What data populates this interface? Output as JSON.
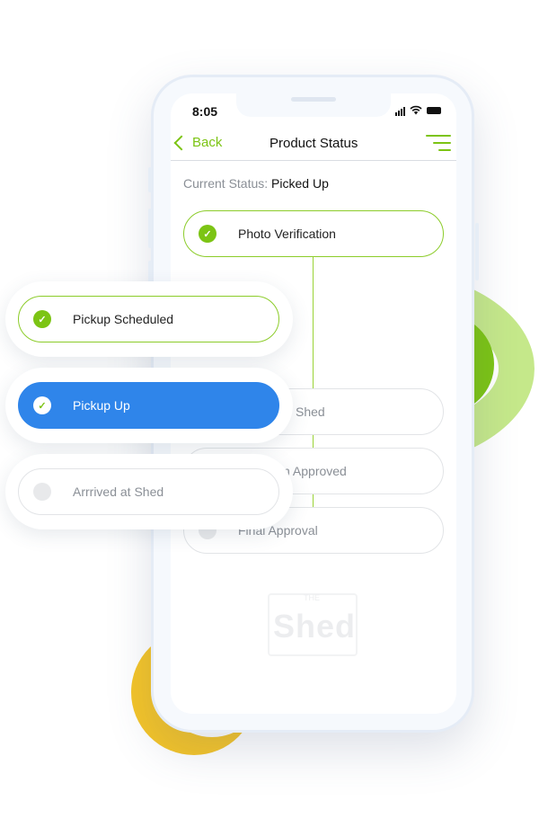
{
  "status_bar": {
    "time": "8:05"
  },
  "nav": {
    "back_label": "Back",
    "title": "Product Status"
  },
  "current_status": {
    "label": "Current Status:",
    "value": "Picked Up"
  },
  "timeline": [
    {
      "label": "Photo Verification",
      "state": "done"
    },
    {
      "label": "Shed",
      "state": "pending"
    },
    {
      "label": "n Approved",
      "state": "pending"
    },
    {
      "label": "Final Approval",
      "state": "pending"
    }
  ],
  "floating_cards": [
    {
      "label": "Pickup Scheduled",
      "state": "done"
    },
    {
      "label": "Pickup Up",
      "state": "active"
    },
    {
      "label": "Arrrived at Shed",
      "state": "pending"
    }
  ],
  "watermark": {
    "the": "THE",
    "word": "Shed"
  },
  "colors": {
    "accent_green": "#7cc414",
    "active_blue": "#2f85ea",
    "deco_yellow": "#f4c428",
    "deco_light_green": "#c5e88a"
  },
  "icons": {
    "check": "check-icon",
    "menu": "menu-icon",
    "back": "chevron-left-icon"
  }
}
